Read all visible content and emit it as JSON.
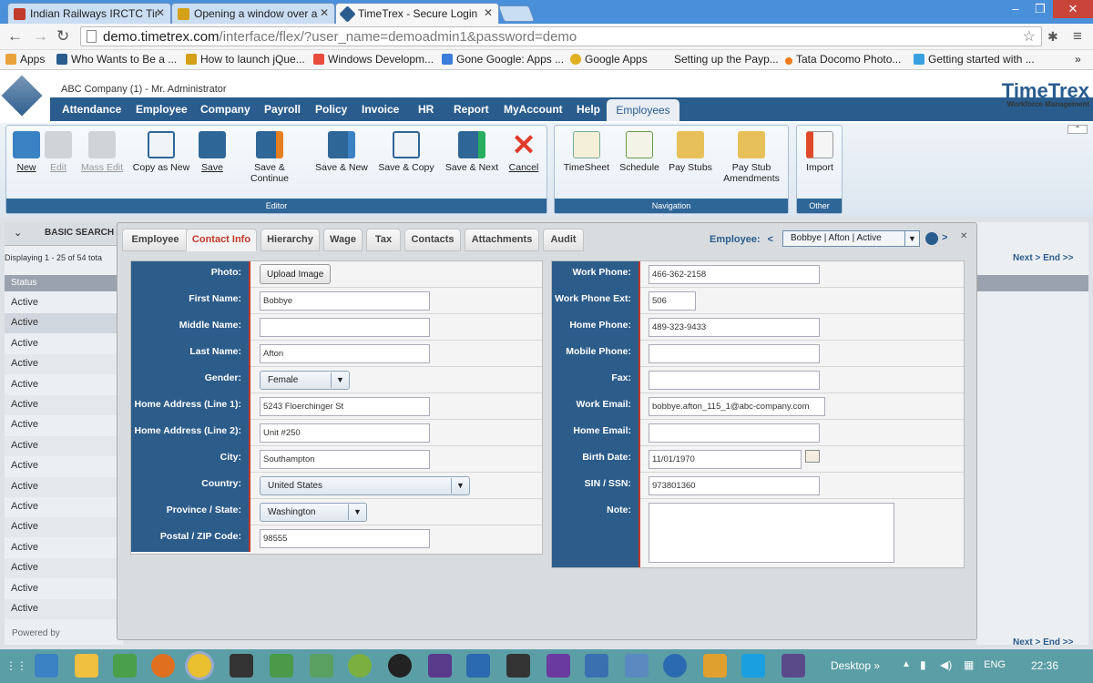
{
  "browser": {
    "tabs": [
      {
        "title": "Indian Railways IRCTC Tir",
        "color": "#c0392b"
      },
      {
        "title": "Opening a window over a",
        "color": "#d4a017"
      },
      {
        "title": "TimeTrex - Secure Login",
        "color": "#2a5d8e"
      }
    ],
    "url_prefix": "demo.timetrex.com",
    "url_rest": "/interface/flex/?user_name=demoadmin1&password=demo",
    "bookmarks": [
      "Apps",
      "Who Wants to Be a ...",
      "How to launch jQue...",
      "Windows Developm...",
      "Gone Google: Apps ...",
      "Google Apps",
      "Setting up the Payp...",
      "Tata Docomo Photo...",
      "Getting started with ..."
    ],
    "more": "»"
  },
  "app": {
    "company": "ABC Company (1) - Mr. Administrator",
    "logo_text": "TimeTrex",
    "logo_sub": "Workforce Management",
    "menu": [
      "Attendance",
      "Employee",
      "Company",
      "Payroll",
      "Policy",
      "Invoice",
      "HR",
      "Report",
      "MyAccount",
      "Help"
    ],
    "active_tab": "Employees"
  },
  "toolbar": {
    "editor": [
      "New",
      "Edit",
      "Mass Edit",
      "Copy as New",
      "Save",
      "Save & Continue",
      "Save & New",
      "Save & Copy",
      "Save & Next",
      "Cancel"
    ],
    "editor_label": "Editor",
    "navigation": [
      "TimeSheet",
      "Schedule",
      "Pay Stubs",
      "Pay Stub Amendments"
    ],
    "navigation_label": "Navigation",
    "other": [
      "Import"
    ],
    "other_label": "Other"
  },
  "background": {
    "search": "BASIC SEARCH",
    "displaying": "Displaying 1 - 25 of 54 tota",
    "status_header": "Status",
    "status_value": "Active",
    "powered": "Powered by",
    "next": "Next >",
    "end": "End >>"
  },
  "dialog": {
    "tabs": [
      "Employee",
      "Contact Info",
      "Hierarchy",
      "Wage",
      "Tax",
      "Contacts",
      "Attachments",
      "Audit"
    ],
    "employee_label": "Employee:",
    "employee_value": "Bobbye | Afton | Active",
    "left": {
      "photo_label": "Photo:",
      "upload": "Upload Image",
      "first_name_label": "First Name:",
      "first_name": "Bobbye",
      "middle_name_label": "Middle Name:",
      "middle_name": "",
      "last_name_label": "Last Name:",
      "last_name": "Afton",
      "gender_label": "Gender:",
      "gender": "Female",
      "addr1_label": "Home Address (Line 1):",
      "addr1": "5243 Floerchinger St",
      "addr2_label": "Home Address (Line 2):",
      "addr2": "Unit #250",
      "city_label": "City:",
      "city": "Southampton",
      "country_label": "Country:",
      "country": "United States",
      "state_label": "Province / State:",
      "state": "Washington",
      "zip_label": "Postal / ZIP Code:",
      "zip": "98555"
    },
    "right": {
      "work_phone_label": "Work Phone:",
      "work_phone": "466-362-2158",
      "work_ext_label": "Work Phone Ext:",
      "work_ext": "506",
      "home_phone_label": "Home Phone:",
      "home_phone": "489-323-9433",
      "mobile_label": "Mobile Phone:",
      "mobile": "",
      "fax_label": "Fax:",
      "fax": "",
      "work_email_label": "Work Email:",
      "work_email": "bobbye.afton_115_1@abc-company.com",
      "home_email_label": "Home Email:",
      "home_email": "",
      "birth_label": "Birth Date:",
      "birth": "11/01/1970",
      "sin_label": "SIN / SSN:",
      "sin": "973801360",
      "note_label": "Note:",
      "note": ""
    }
  },
  "taskbar": {
    "desktop": "Desktop",
    "lang": "ENG",
    "time": "22:36"
  }
}
